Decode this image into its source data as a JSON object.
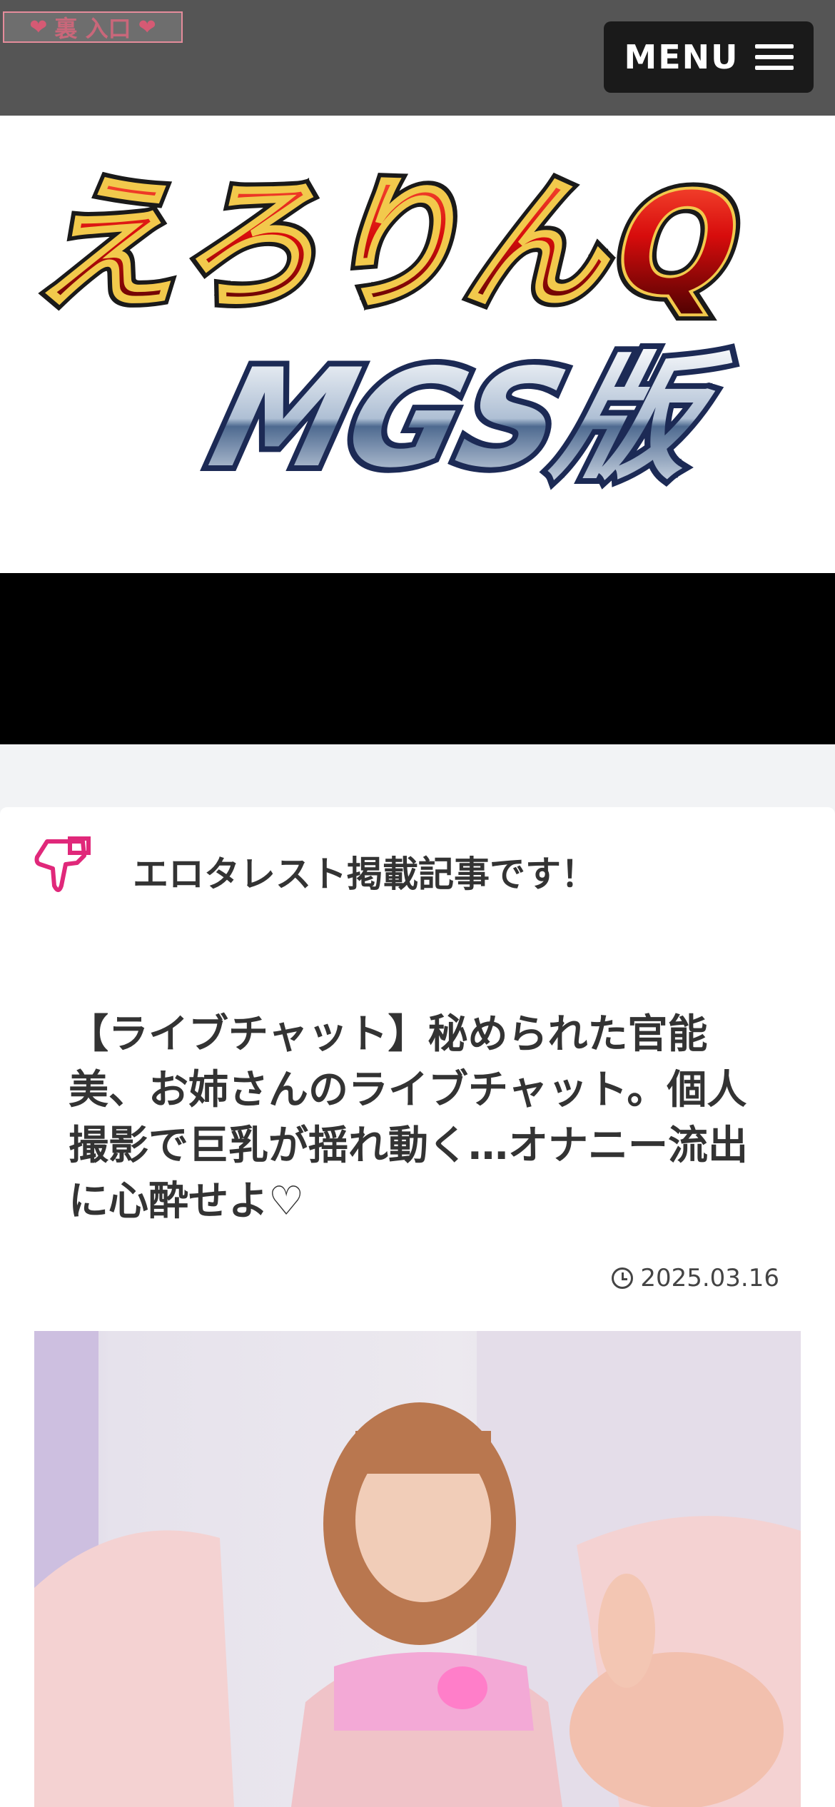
{
  "topbar": {
    "back_link_label": "裏 入口",
    "menu_label": "MENU"
  },
  "logo": {
    "line1": "えろりんQ",
    "line2": "MGS版"
  },
  "notice": {
    "text": "エロタレスト掲載記事です！",
    "icon": "pointing-hand-icon"
  },
  "article": {
    "title": "【ライブチャット】秘められた官能美、お姉さんのライブチャット。個人撮影で巨乳が揺れ動く…オナニー流出に心酔せよ♡",
    "date": "2025.03.16"
  },
  "colors": {
    "topbar_bg": "#555555",
    "menu_bg": "#1a1a1a",
    "accent_pink": "#e0287a",
    "logo_red": "#d41010",
    "logo_navy": "#1c2a55"
  }
}
